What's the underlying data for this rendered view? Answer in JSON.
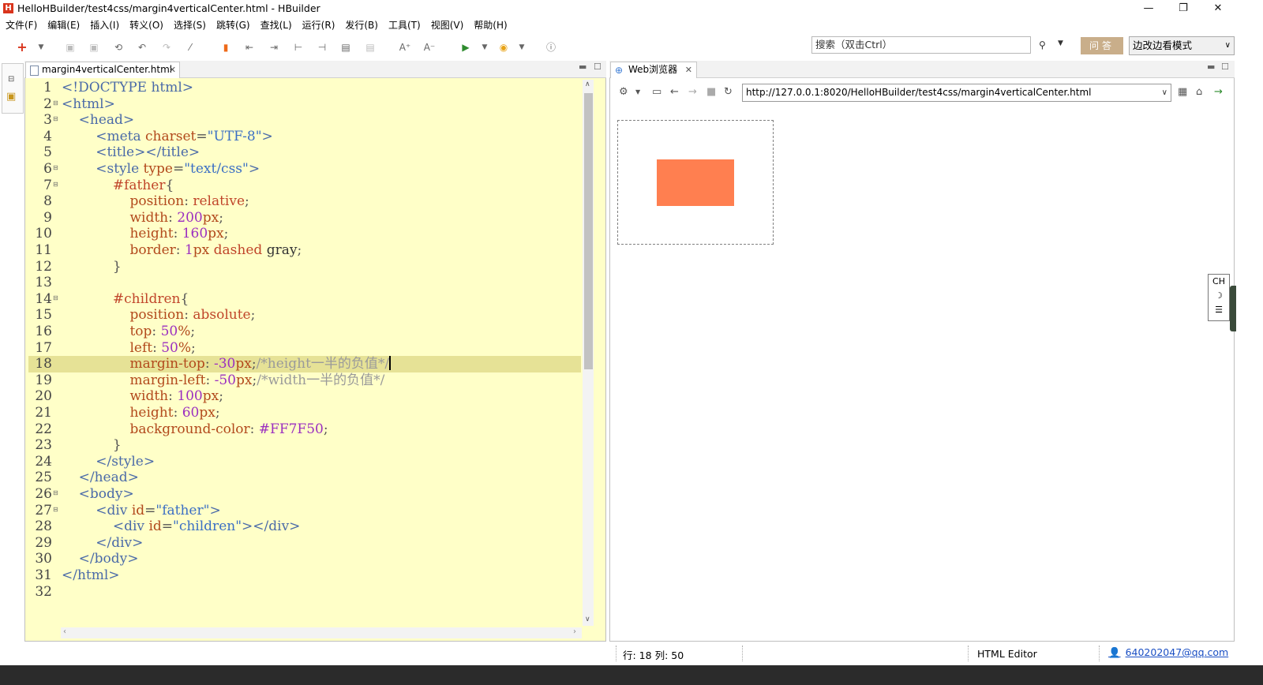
{
  "window": {
    "title": "HelloHBuilder/test4css/margin4verticalCenter.html  -  HBuilder",
    "logo": "H",
    "controls": {
      "minimize": "—",
      "maximize": "❐",
      "close": "✕"
    }
  },
  "menu": [
    "文件(F)",
    "编辑(E)",
    "插入(I)",
    "转义(O)",
    "选择(S)",
    "跳转(G)",
    "查找(L)",
    "运行(R)",
    "发行(B)",
    "工具(T)",
    "视图(V)",
    "帮助(H)"
  ],
  "toolbar": {
    "search_placeholder": "搜索（双击Ctrl）",
    "search_icon": "search-icon",
    "qa_label": "问答",
    "mode_label": "边改边看模式"
  },
  "editor": {
    "tab_label": "margin4verticalCenter.html",
    "current_line": 18,
    "lines": [
      {
        "n": "1",
        "fold": false
      },
      {
        "n": "2",
        "fold": true
      },
      {
        "n": "3",
        "fold": true
      },
      {
        "n": "4",
        "fold": false
      },
      {
        "n": "5",
        "fold": false
      },
      {
        "n": "6",
        "fold": true
      },
      {
        "n": "7",
        "fold": true
      },
      {
        "n": "8",
        "fold": false
      },
      {
        "n": "9",
        "fold": false
      },
      {
        "n": "10",
        "fold": false
      },
      {
        "n": "11",
        "fold": false
      },
      {
        "n": "12",
        "fold": false
      },
      {
        "n": "13",
        "fold": false
      },
      {
        "n": "14",
        "fold": true
      },
      {
        "n": "15",
        "fold": false
      },
      {
        "n": "16",
        "fold": false
      },
      {
        "n": "17",
        "fold": false
      },
      {
        "n": "18",
        "fold": false
      },
      {
        "n": "19",
        "fold": false
      },
      {
        "n": "20",
        "fold": false
      },
      {
        "n": "21",
        "fold": false
      },
      {
        "n": "22",
        "fold": false
      },
      {
        "n": "23",
        "fold": false
      },
      {
        "n": "24",
        "fold": false
      },
      {
        "n": "25",
        "fold": false
      },
      {
        "n": "26",
        "fold": true
      },
      {
        "n": "27",
        "fold": true
      },
      {
        "n": "28",
        "fold": false
      },
      {
        "n": "29",
        "fold": false
      },
      {
        "n": "30",
        "fold": false
      },
      {
        "n": "31",
        "fold": false
      },
      {
        "n": "32",
        "fold": false
      }
    ],
    "code": [
      [
        [
          "tag",
          "<!DOCTYPE html>"
        ]
      ],
      [
        [
          "tag",
          "<html>"
        ]
      ],
      [
        [
          "plain",
          "    "
        ],
        [
          "tag",
          "<head>"
        ]
      ],
      [
        [
          "plain",
          "        "
        ],
        [
          "tag",
          "<meta "
        ],
        [
          "attr",
          "charset"
        ],
        [
          "punc",
          "="
        ],
        [
          "str",
          "\"UTF-8\""
        ],
        [
          "tag",
          ">"
        ]
      ],
      [
        [
          "plain",
          "        "
        ],
        [
          "tag",
          "<title></title>"
        ]
      ],
      [
        [
          "plain",
          "        "
        ],
        [
          "tag",
          "<style "
        ],
        [
          "attr",
          "type"
        ],
        [
          "punc",
          "="
        ],
        [
          "str",
          "\"text/css\""
        ],
        [
          "tag",
          ">"
        ]
      ],
      [
        [
          "plain",
          "            "
        ],
        [
          "sel",
          "#father"
        ],
        [
          "punc",
          "{"
        ]
      ],
      [
        [
          "plain",
          "                "
        ],
        [
          "prop",
          "position"
        ],
        [
          "punc",
          ": "
        ],
        [
          "val",
          "relative"
        ],
        [
          "punc",
          ";"
        ]
      ],
      [
        [
          "plain",
          "                "
        ],
        [
          "prop",
          "width"
        ],
        [
          "punc",
          ": "
        ],
        [
          "num",
          "200"
        ],
        [
          "unit",
          "px"
        ],
        [
          "punc",
          ";"
        ]
      ],
      [
        [
          "plain",
          "                "
        ],
        [
          "prop",
          "height"
        ],
        [
          "punc",
          ": "
        ],
        [
          "num",
          "160"
        ],
        [
          "unit",
          "px"
        ],
        [
          "punc",
          ";"
        ]
      ],
      [
        [
          "plain",
          "                "
        ],
        [
          "prop",
          "border"
        ],
        [
          "punc",
          ": "
        ],
        [
          "num",
          "1"
        ],
        [
          "unit",
          "px "
        ],
        [
          "val",
          "dashed "
        ],
        [
          "plain",
          "gray"
        ],
        [
          "punc",
          ";"
        ]
      ],
      [
        [
          "plain",
          "            "
        ],
        [
          "punc",
          "}"
        ]
      ],
      [
        [
          "plain",
          ""
        ]
      ],
      [
        [
          "plain",
          "            "
        ],
        [
          "sel",
          "#children"
        ],
        [
          "punc",
          "{"
        ]
      ],
      [
        [
          "plain",
          "                "
        ],
        [
          "prop",
          "position"
        ],
        [
          "punc",
          ": "
        ],
        [
          "val",
          "absolute"
        ],
        [
          "punc",
          ";"
        ]
      ],
      [
        [
          "plain",
          "                "
        ],
        [
          "prop",
          "top"
        ],
        [
          "punc",
          ": "
        ],
        [
          "num",
          "50"
        ],
        [
          "unit",
          "%"
        ],
        [
          "punc",
          ";"
        ]
      ],
      [
        [
          "plain",
          "                "
        ],
        [
          "prop",
          "left"
        ],
        [
          "punc",
          ": "
        ],
        [
          "num",
          "50"
        ],
        [
          "unit",
          "%"
        ],
        [
          "punc",
          ";"
        ]
      ],
      [
        [
          "plain",
          "                "
        ],
        [
          "prop",
          "margin-top"
        ],
        [
          "punc",
          ": "
        ],
        [
          "num",
          "-30"
        ],
        [
          "unit",
          "px"
        ],
        [
          "punc",
          ";"
        ],
        [
          "cmt",
          "/*height一半的负值*/"
        ]
      ],
      [
        [
          "plain",
          "                "
        ],
        [
          "prop",
          "margin-left"
        ],
        [
          "punc",
          ": "
        ],
        [
          "num",
          "-50"
        ],
        [
          "unit",
          "px"
        ],
        [
          "punc",
          ";"
        ],
        [
          "cmt",
          "/*width一半的负值*/"
        ]
      ],
      [
        [
          "plain",
          "                "
        ],
        [
          "prop",
          "width"
        ],
        [
          "punc",
          ": "
        ],
        [
          "num",
          "100"
        ],
        [
          "unit",
          "px"
        ],
        [
          "punc",
          ";"
        ]
      ],
      [
        [
          "plain",
          "                "
        ],
        [
          "prop",
          "height"
        ],
        [
          "punc",
          ": "
        ],
        [
          "num",
          "60"
        ],
        [
          "unit",
          "px"
        ],
        [
          "punc",
          ";"
        ]
      ],
      [
        [
          "plain",
          "                "
        ],
        [
          "prop",
          "background-color"
        ],
        [
          "punc",
          ": "
        ],
        [
          "num",
          "#FF7F50"
        ],
        [
          "punc",
          ";"
        ]
      ],
      [
        [
          "plain",
          "            "
        ],
        [
          "punc",
          "}"
        ]
      ],
      [
        [
          "plain",
          "        "
        ],
        [
          "tag",
          "</style>"
        ]
      ],
      [
        [
          "plain",
          "    "
        ],
        [
          "tag",
          "</head>"
        ]
      ],
      [
        [
          "plain",
          "    "
        ],
        [
          "tag",
          "<body>"
        ]
      ],
      [
        [
          "plain",
          "        "
        ],
        [
          "tag",
          "<div "
        ],
        [
          "attr",
          "id"
        ],
        [
          "punc",
          "="
        ],
        [
          "str",
          "\"father\""
        ],
        [
          "tag",
          ">"
        ]
      ],
      [
        [
          "plain",
          "            "
        ],
        [
          "tag",
          "<div "
        ],
        [
          "attr",
          "id"
        ],
        [
          "punc",
          "="
        ],
        [
          "str",
          "\"children\""
        ],
        [
          "tag",
          "></div>"
        ]
      ],
      [
        [
          "plain",
          "        "
        ],
        [
          "tag",
          "</div>"
        ]
      ],
      [
        [
          "plain",
          "    "
        ],
        [
          "tag",
          "</body>"
        ]
      ],
      [
        [
          "tag",
          "</html>"
        ]
      ],
      [
        [
          "plain",
          ""
        ]
      ]
    ]
  },
  "browser": {
    "tab_label": "Web浏览器",
    "url": "http://127.0.0.1:8020/HelloHBuilder/test4css/margin4verticalCenter.html",
    "preview": {
      "child_color": "#FF7F50",
      "border_color": "#808080"
    },
    "ime": {
      "lang": "CH",
      "moon": "☽",
      "menu": "☰"
    }
  },
  "status": {
    "position": "行: 18 列: 50",
    "editor_type": "HTML Editor",
    "user": "640202047@qq.com"
  },
  "colors": {
    "editor_bg": "#FFFFC8",
    "current_line_bg": "#E6E296",
    "accent": "#D9341C"
  }
}
